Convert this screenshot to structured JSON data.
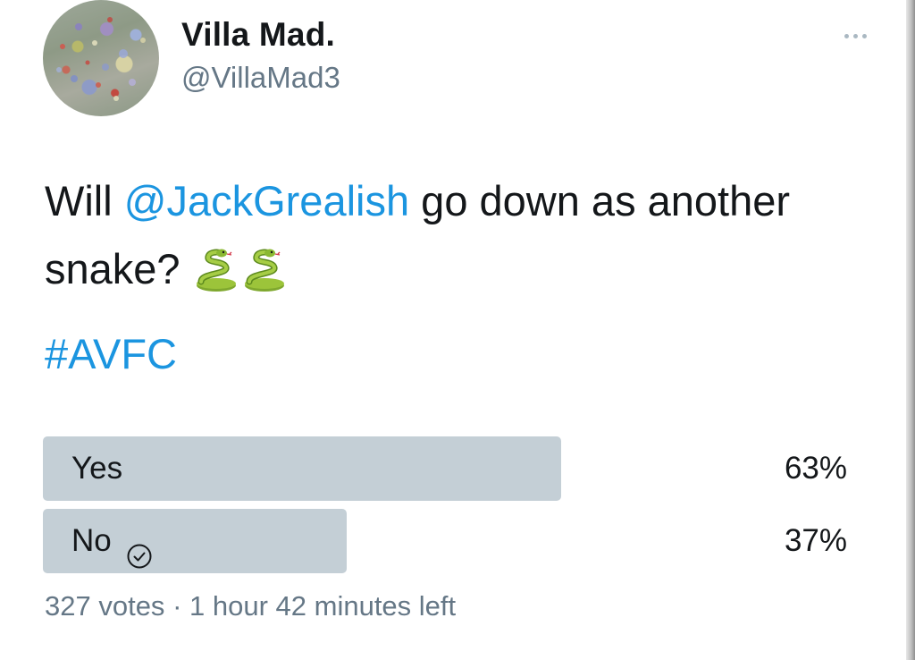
{
  "author": {
    "display_name": "Villa Mad.",
    "handle": "@VillaMad3",
    "avatar_icon": "flower-meadow-avatar"
  },
  "menu": {
    "more_icon": "more-options-icon"
  },
  "tweet": {
    "text_before": "Will ",
    "mention": "@JackGrealish",
    "text_after": " go down as another snake? ",
    "emoji_icon": "snake-icon",
    "emoji_count": 2,
    "hashtag": "#AVFC"
  },
  "poll": {
    "options": [
      {
        "label": "Yes",
        "percent_text": "63%",
        "share": 0.63,
        "selected": false
      },
      {
        "label": "No",
        "percent_text": "37%",
        "share": 0.37,
        "selected": true,
        "check_icon": "check-circle-icon"
      }
    ],
    "votes_text": "327 votes",
    "separator": "·",
    "time_left": "1 hour 42 minutes left"
  },
  "colors": {
    "link": "#1b95e0",
    "secondary_text": "#657786",
    "poll_bar": "#c4cfd6",
    "primary_text": "#14171a"
  }
}
